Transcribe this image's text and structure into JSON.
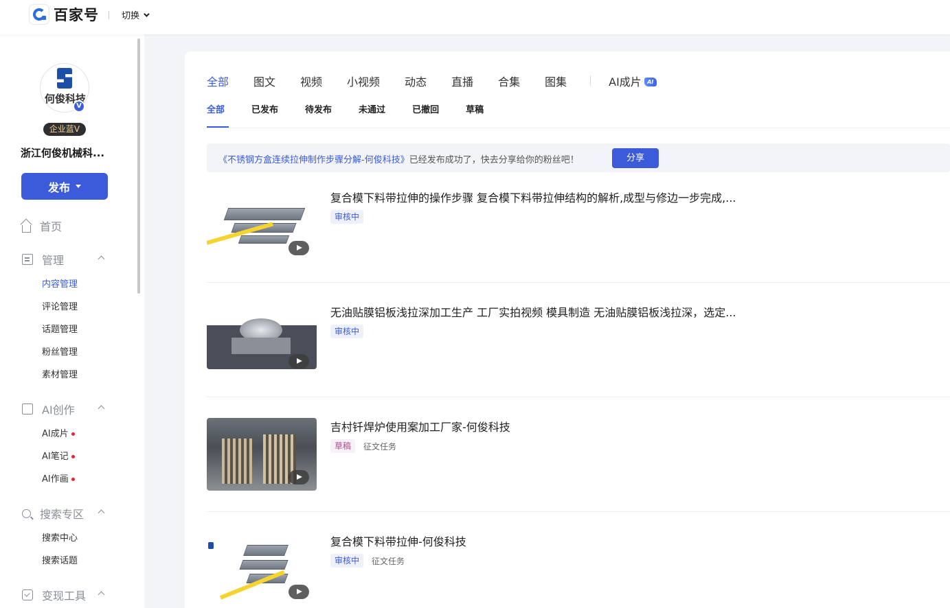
{
  "header": {
    "logo_text": "百家号",
    "switch_label": "切换"
  },
  "sidebar": {
    "avatar_name": "何俊科技",
    "verify_badge": "V",
    "enterprise_badge": "企业蓝V",
    "org_name": "浙江何俊机械科...",
    "publish_label": "发布",
    "home": "首页",
    "groups": [
      {
        "label": "管理",
        "icon": "doc-icon"
      },
      {
        "label": "AI创作",
        "icon": "ai-icon"
      },
      {
        "label": "搜索专区",
        "icon": "search-icon"
      },
      {
        "label": "变现工具",
        "icon": "tool-icon"
      }
    ],
    "manage_items": [
      "内容管理",
      "评论管理",
      "话题管理",
      "粉丝管理",
      "素材管理"
    ],
    "ai_items": [
      "AI成片",
      "AI笔记",
      "AI作画"
    ],
    "search_items": [
      "搜索中心",
      "搜索话题"
    ],
    "active_item": "内容管理"
  },
  "content_tabs": [
    "全部",
    "图文",
    "视频",
    "小视频",
    "动态",
    "直播",
    "合集",
    "图集",
    "AI成片"
  ],
  "ai_tag": "AI",
  "status_tabs": [
    "全部",
    "已发布",
    "待发布",
    "未通过",
    "已撤回",
    "草稿"
  ],
  "notice": {
    "link_text": "《不锈钢方盒连续拉伸制作步骤分解-何俊科技》",
    "text": "已经发布成功了，快去分享给你的粉丝吧！",
    "share_label": "分享"
  },
  "items": [
    {
      "title": "复合模下料带拉伸的操作步骤 复合模下料带拉伸结构的解析,成型与修边一步完成,...",
      "status": "审核中",
      "extra": ""
    },
    {
      "title": "无油贴膜铝板浅拉深加工生产 工厂实拍视频 模具制造 无油贴膜铝板浅拉深，选定...",
      "status": "审核中",
      "extra": ""
    },
    {
      "title": "吉村钎焊炉使用案加工厂家-何俊科技",
      "status": "草稿",
      "extra": "征文任务"
    },
    {
      "title": "复合模下料带拉伸-何俊科技",
      "status": "审核中",
      "extra": "征文任务"
    }
  ],
  "colors": {
    "accent": "#3b5bdb",
    "red_dot": "#e5233b"
  }
}
